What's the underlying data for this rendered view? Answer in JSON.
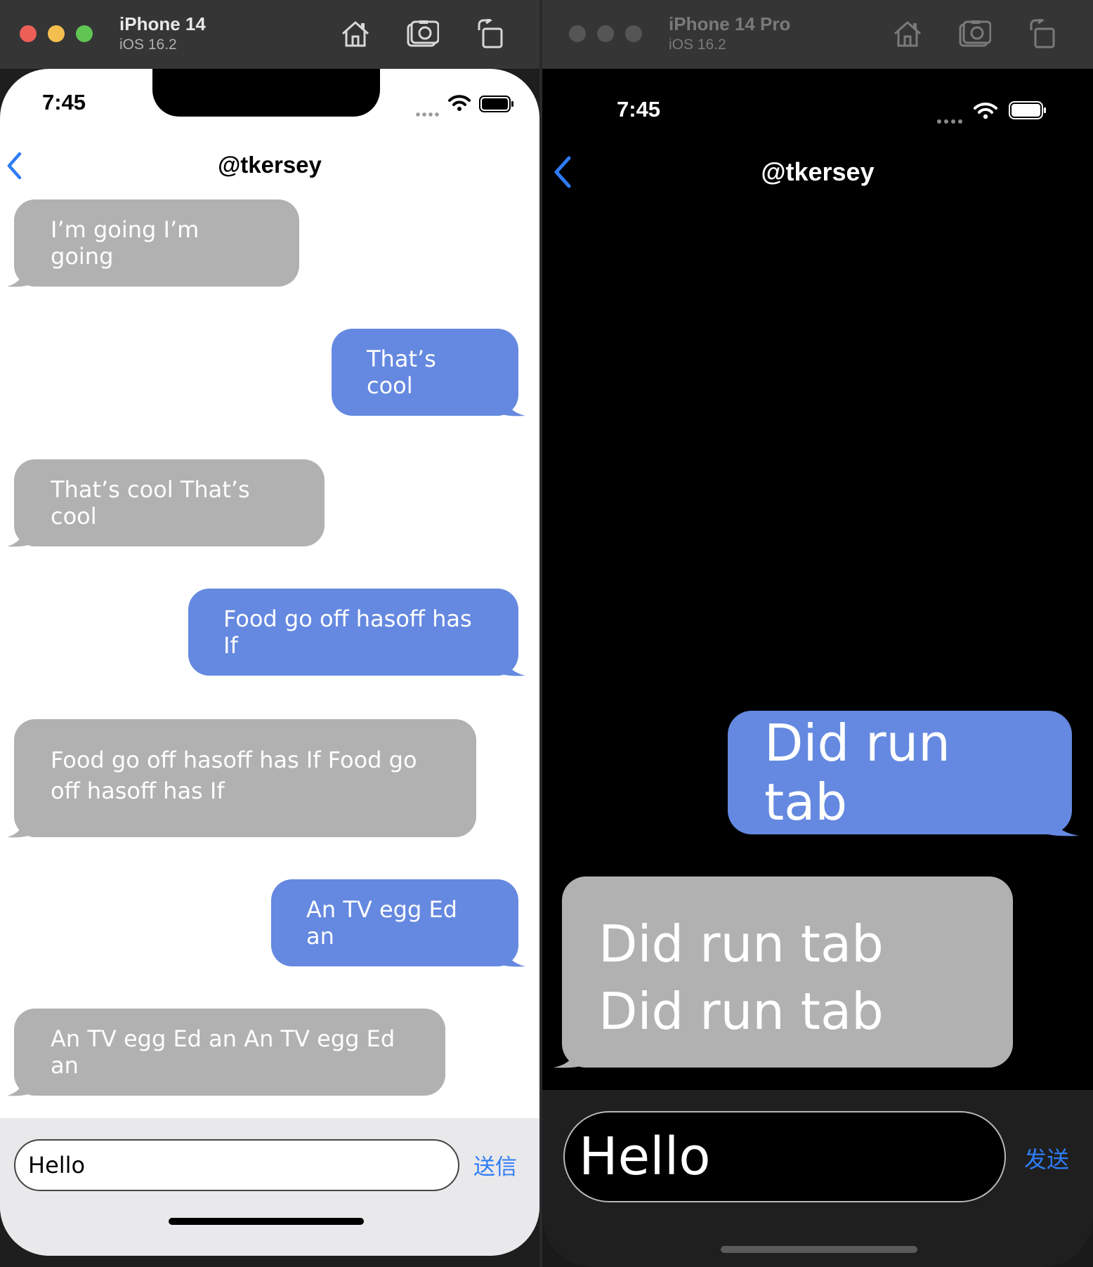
{
  "left": {
    "device": "iPhone 14",
    "os": "iOS 16.2",
    "time": "7:45",
    "nav_title": "@tkersey",
    "messages": [
      {
        "side": "received",
        "text": "I’m going  I’m going"
      },
      {
        "side": "sent",
        "text": "That’s cool"
      },
      {
        "side": "received",
        "text": "That’s cool That’s cool"
      },
      {
        "side": "sent",
        "text": "Food go off hasoff has If"
      },
      {
        "side": "received",
        "text": "Food go off hasoff has If Food go off hasoff has If"
      },
      {
        "side": "sent",
        "text": "An TV egg Ed an"
      },
      {
        "side": "received",
        "text": "An TV egg Ed an An TV egg Ed an"
      }
    ],
    "input_value": "Hello",
    "send_label": "送信"
  },
  "right": {
    "device": "iPhone 14 Pro",
    "os": "iOS 16.2",
    "time": "7:45",
    "nav_title": "@tkersey",
    "messages": [
      {
        "side": "sent",
        "text": "Did run  tab"
      },
      {
        "side": "received",
        "text": "Did run  tab Did run  tab"
      }
    ],
    "input_value": "Hello",
    "send_label": "发送"
  },
  "colors": {
    "sent_bubble": "#6589e0",
    "received_bubble": "#b1b1b1",
    "accent": "#2e7cf6",
    "close": "#ec5f57",
    "minimize": "#f4bf4f",
    "zoom": "#61c554"
  },
  "icons": {
    "home": "home-icon",
    "screenshot": "camera-icon",
    "rotate": "rotate-icon",
    "back": "chevron-left-icon",
    "wifi": "wifi-icon",
    "battery": "battery-icon",
    "signal": "signal-icon"
  }
}
